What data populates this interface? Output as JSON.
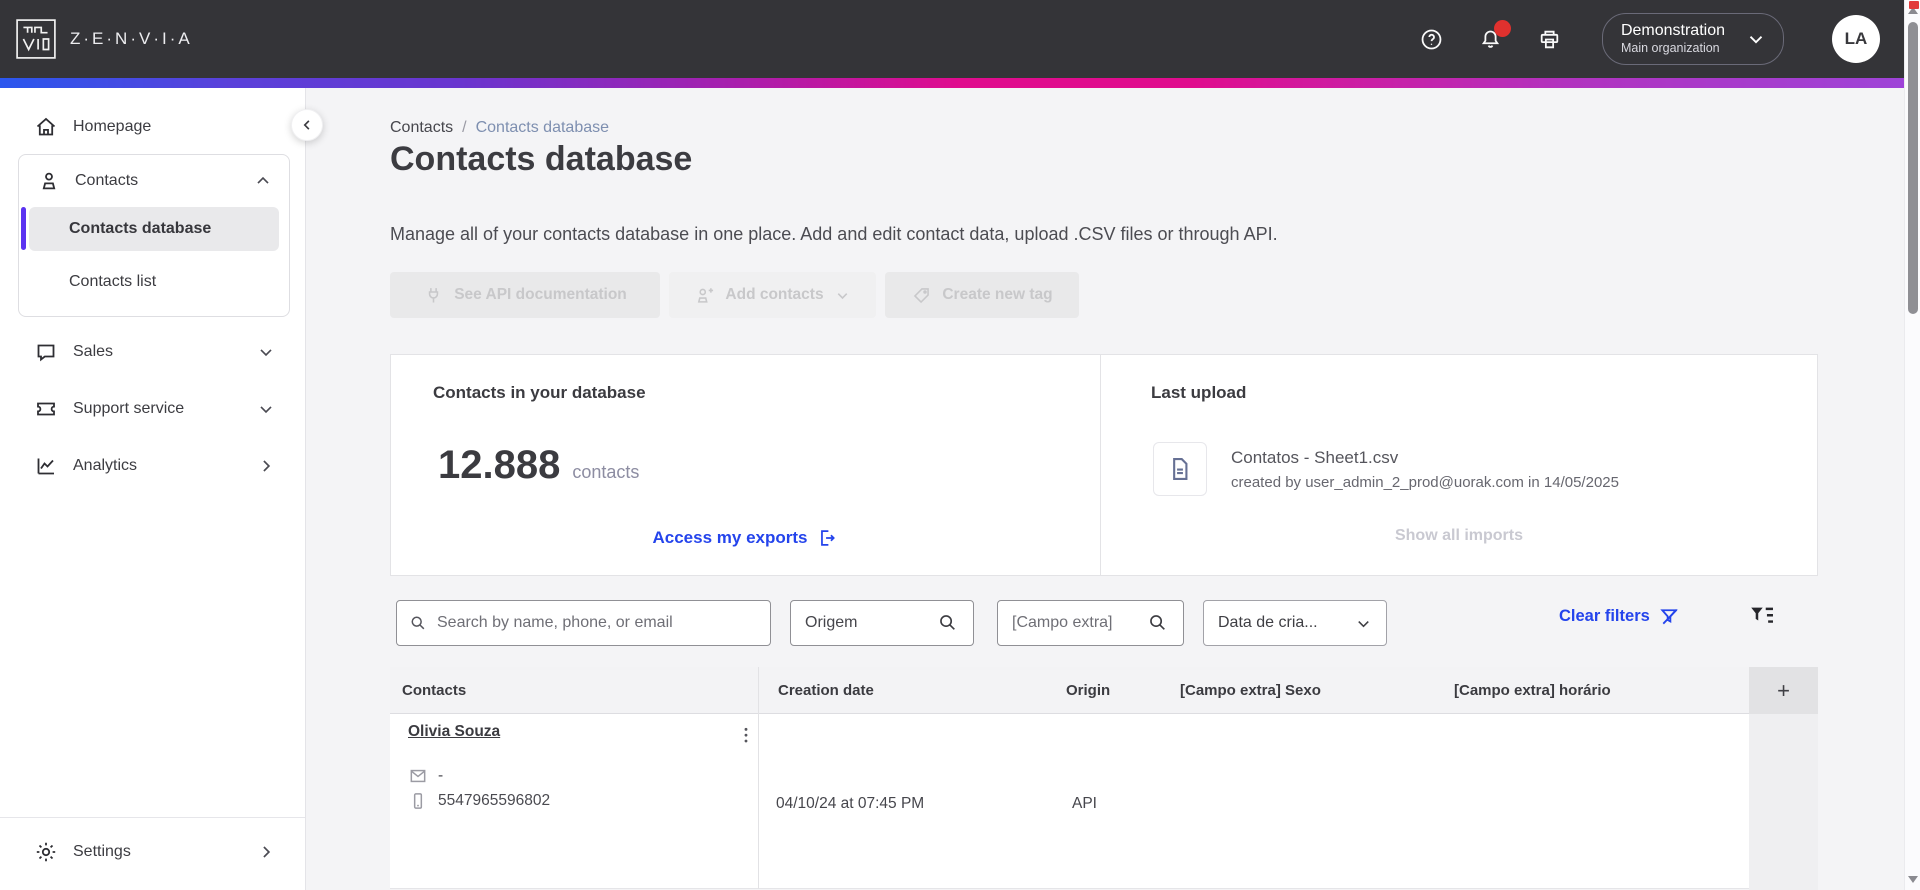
{
  "header": {
    "brand": "Z·E·N·V·I·A",
    "org_name": "Demonstration",
    "org_sub": "Main organization",
    "avatar_initials": "LA"
  },
  "sidebar": {
    "homepage": "Homepage",
    "contacts_group": {
      "label": "Contacts",
      "items": [
        {
          "label": "Contacts database",
          "selected": true
        },
        {
          "label": "Contacts list",
          "selected": false
        }
      ]
    },
    "items": [
      {
        "label": "Sales"
      },
      {
        "label": "Support service"
      },
      {
        "label": "Analytics"
      }
    ],
    "settings": "Settings"
  },
  "breadcrumb": {
    "parent": "Contacts",
    "separator": "/",
    "current": "Contacts database"
  },
  "page": {
    "title": "Contacts database",
    "subtitle": "Manage all of your contacts database in one place. Add and edit contact data, upload .CSV files or through API."
  },
  "actions": {
    "see_api_documentation": "See API documentation",
    "add_contacts": "Add contacts",
    "create_new_tag": "Create new tag"
  },
  "database_card": {
    "title": "Contacts in your database",
    "count": "12.888",
    "count_unit": "contacts",
    "exports_link": "Access my exports"
  },
  "last_upload_card": {
    "title": "Last upload",
    "file_name": "Contatos - Sheet1.csv",
    "file_meta": "created by user_admin_2_prod@uorak.com in 14/05/2025",
    "show_all_label": "Show all imports"
  },
  "filters": {
    "search_placeholder": "Search by name, phone, or email",
    "origem_value": "Origem",
    "campo_extra_placeholder": "[Campo extra]",
    "date_label": "Data de cria...",
    "clear_label": "Clear filters"
  },
  "table": {
    "columns": [
      "Contacts",
      "Creation date",
      "Origin",
      "[Campo extra] Sexo",
      "[Campo extra] horário"
    ],
    "add_column_label": "+",
    "rows": [
      {
        "name": "Olivia Souza",
        "email": "-",
        "phone": "5547965596802",
        "creation_date": "04/10/24 at 07:45 PM",
        "origin": "API",
        "campo_sexo": "",
        "campo_horario": ""
      }
    ]
  },
  "icons": {
    "help": "question-mark-circle",
    "notifications": "bell + red dot",
    "print": "printer",
    "org_chevron": "chevron-down",
    "collapse": "chevron-left",
    "search": "magnifier",
    "clear_filters": "funnel-slash",
    "advanced_filter": "funnel-lines",
    "exports": "document-arrow-out",
    "file": "document",
    "email": "envelope",
    "phone": "mobile",
    "row_menu": "kebab-vertical"
  },
  "colors": {
    "topbar_bg": "#343438",
    "accent_purple": "#5b33f1",
    "link_blue": "#2444ec",
    "notification_red": "#e0312e",
    "gradient": [
      "#2b57ee",
      "#e00c8e",
      "#9d44d9"
    ]
  }
}
